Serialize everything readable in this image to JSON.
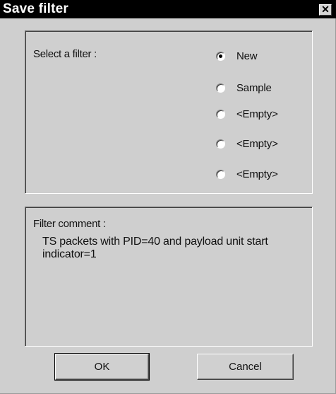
{
  "window": {
    "title": "Save filter",
    "close_glyph": "✕"
  },
  "filter_group": {
    "label": "Select a filter :",
    "options": [
      {
        "label": "New",
        "checked": true
      },
      {
        "label": "Sample",
        "checked": false
      },
      {
        "label": "<Empty>",
        "checked": false
      },
      {
        "label": "<Empty>",
        "checked": false
      },
      {
        "label": "<Empty>",
        "checked": false
      }
    ]
  },
  "comment_group": {
    "label": "Filter comment :",
    "text": "TS packets with PID=40 and payload unit start indicator=1"
  },
  "buttons": {
    "ok": "OK",
    "cancel": "Cancel"
  }
}
